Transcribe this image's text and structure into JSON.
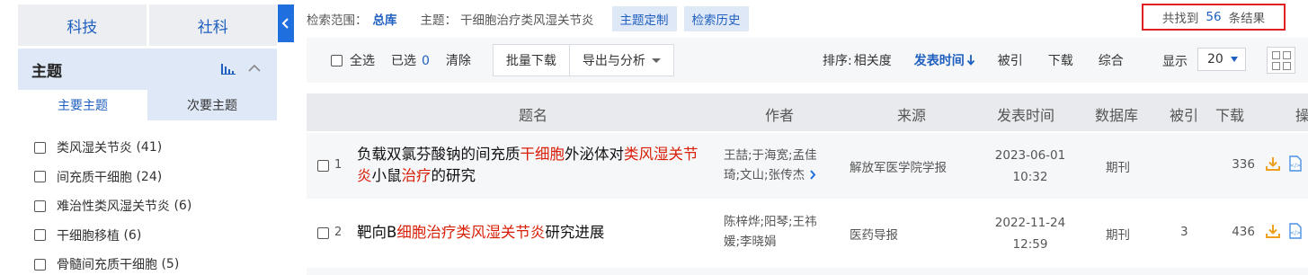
{
  "sidebar": {
    "category_tabs": [
      "科技",
      "社科"
    ],
    "facet_title": "主题",
    "subtabs": {
      "primary": "主要主题",
      "secondary": "次要主题"
    },
    "facet_items": [
      {
        "label": "类风湿关节炎",
        "count": "(41)"
      },
      {
        "label": "间充质干细胞",
        "count": "(24)"
      },
      {
        "label": "难治性类风湿关节炎",
        "count": "(6)"
      },
      {
        "label": "干细胞移植",
        "count": "(6)"
      },
      {
        "label": "骨髓间充质干细胞",
        "count": "(5)"
      }
    ]
  },
  "infobar": {
    "scope_label": "检索范围：",
    "scope_value": "总库",
    "topic_label": "主题：",
    "topic_value": "干细胞治疗类风湿关节炎",
    "custom_topic_button": "主题定制",
    "history_button": "检索历史",
    "result_prefix": "共找到",
    "result_count": "56",
    "result_suffix": "条结果"
  },
  "toolbar": {
    "select_all": "全选",
    "selected_label": "已选",
    "selected_count": "0",
    "clear": "清除",
    "batch_download": "批量下载",
    "export_analyze": "导出与分析",
    "sort_label": "排序:",
    "sort_options": [
      {
        "label": "相关度",
        "active": false
      },
      {
        "label": "发表时间",
        "active": true
      },
      {
        "label": "被引",
        "active": false
      },
      {
        "label": "下载",
        "active": false
      },
      {
        "label": "综合",
        "active": false
      }
    ],
    "show_label": "显示",
    "page_size": "20"
  },
  "table": {
    "headers": [
      "题名",
      "作者",
      "来源",
      "发表时间",
      "数据库",
      "被引",
      "下载",
      "操"
    ],
    "rows": [
      {
        "index": "1",
        "title_parts": [
          {
            "text": "负载双氯芬酸钠的间充质",
            "hl": false
          },
          {
            "text": "干细胞",
            "hl": true
          },
          {
            "text": "外泌体对",
            "hl": false
          },
          {
            "text": "类风湿关节炎",
            "hl": true
          },
          {
            "text": "小鼠",
            "hl": false
          },
          {
            "text": "治疗",
            "hl": true
          },
          {
            "text": "的研究",
            "hl": false
          }
        ],
        "author_line1": "王喆;于海宽;孟佳",
        "author_line2": "琦;文山;张传杰",
        "source": "解放军医学院学报",
        "date": "2023-06-01",
        "time": "10:32",
        "database": "期刊",
        "cited": "",
        "downloads": "336"
      },
      {
        "index": "2",
        "title_parts": [
          {
            "text": "靶向B",
            "hl": false
          },
          {
            "text": "细胞治疗类风湿关节炎",
            "hl": true
          },
          {
            "text": "研究进展",
            "hl": false
          }
        ],
        "author_line1": "陈梓烨;阳琴;王祎",
        "author_line2": "媛;李晓娟",
        "source": "医药导报",
        "date": "2022-11-24",
        "time": "12:59",
        "database": "期刊",
        "cited": "3",
        "downloads": "436"
      }
    ]
  },
  "colors": {
    "accent": "#1f5fbf",
    "highlight": "#d81e06",
    "result_box": "#e02020",
    "header_bg": "#dfe8f7"
  },
  "icons": [
    "chevron-left-icon",
    "bar-chart-icon",
    "chevron-up-icon",
    "sort-down-arrow-icon",
    "grid-view-icon",
    "download-icon",
    "html-file-icon",
    "chevron-right-icon"
  ]
}
